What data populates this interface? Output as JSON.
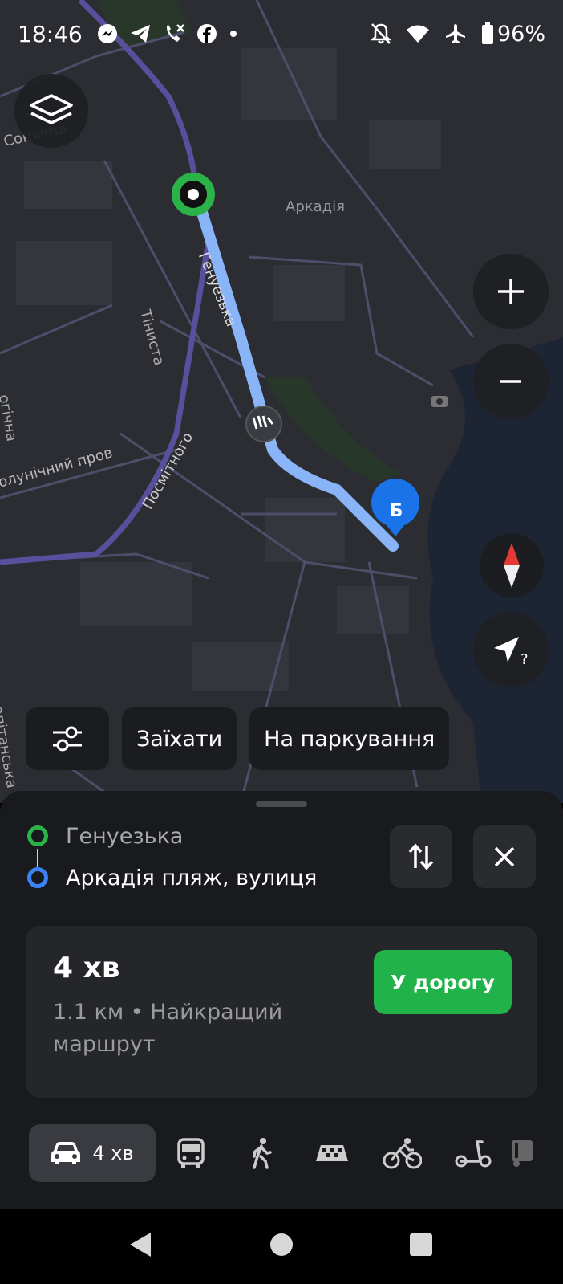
{
  "status_bar": {
    "time": "18:46",
    "battery": "96%",
    "left_icons": [
      "messenger-icon",
      "telegram-icon",
      "missed-call-icon",
      "facebook-icon",
      "dot-icon"
    ],
    "right_icons": [
      "mute-icon",
      "wifi-icon",
      "airplane-icon",
      "battery-icon"
    ]
  },
  "map": {
    "labels": {
      "soniachna": "Сонячна",
      "arkadiia": "Аркадія",
      "henuezka": "Генуезька",
      "tinysta": "Тіниста",
      "poliklinichnyi": "олунічний пров",
      "posmitnoho": "Посмітного",
      "ohichna": "огічна",
      "kapitanska": "апітанська"
    },
    "destination_marker": "Б",
    "colors": {
      "route": "#8ab4f8",
      "start": "#2bb34a",
      "destination": "#1a73e8"
    }
  },
  "chips": {
    "drive_in": "Заїхати",
    "parking": "На паркування"
  },
  "route": {
    "from": "Генуезька",
    "to": "Аркадія пляж, вулиця",
    "duration": "4 хв",
    "details": "1.1 км • Найкращий маршрут",
    "go_label": "У дорогу"
  },
  "transport_modes": {
    "car_time": "4 хв",
    "modes": [
      "car-icon",
      "bus-icon",
      "walk-icon",
      "taxi-icon",
      "bike-icon",
      "scooter-icon",
      "truck-icon"
    ]
  },
  "accent_colors": {
    "go_button": "#21b24a",
    "origin_dot": "#2bb34a",
    "dest_dot": "#3b82f6"
  }
}
